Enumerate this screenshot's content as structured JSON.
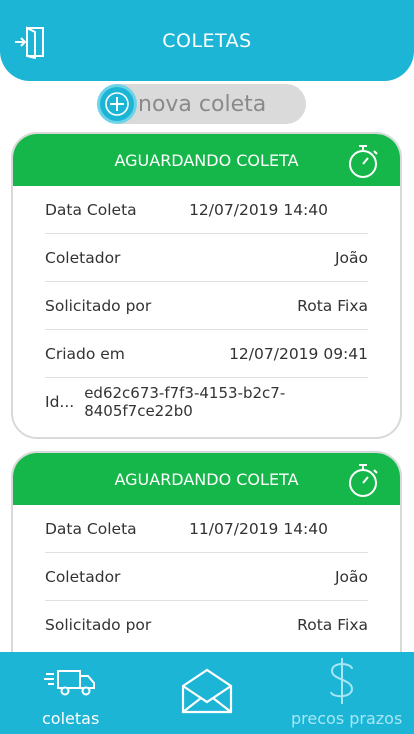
{
  "header": {
    "title": "COLETAS",
    "logout_icon": "logout-icon"
  },
  "new_button": {
    "label": "nova coleta",
    "icon": "plus-circle-icon"
  },
  "cards": [
    {
      "status": "AGUARDANDO COLETA",
      "rows": [
        {
          "label": "Data Coleta",
          "value": "12/07/2019 14:40"
        },
        {
          "label": "Coletador",
          "value": "João"
        },
        {
          "label": "Solicitado por",
          "value": "Rota Fixa"
        },
        {
          "label": "Criado em",
          "value": "12/07/2019 09:41"
        },
        {
          "label": "Id...",
          "value": "ed62c673-f7f3-4153-b2c7-8405f7ce22b0"
        }
      ]
    },
    {
      "status": "AGUARDANDO COLETA",
      "rows": [
        {
          "label": "Data Coleta",
          "value": "11/07/2019 14:40"
        },
        {
          "label": "Coletador",
          "value": "João"
        },
        {
          "label": "Solicitado por",
          "value": "Rota Fixa"
        }
      ]
    }
  ],
  "tabs": [
    {
      "label": "coletas",
      "icon": "truck-icon",
      "active": true
    },
    {
      "label": "",
      "icon": "envelope-icon",
      "active": false
    },
    {
      "label": "precos prazos",
      "icon": "dollar-icon",
      "active": false
    }
  ],
  "colors": {
    "primary": "#1cb5d6",
    "status_green": "#16b74a",
    "tab_inactive": "#a8e6f5"
  }
}
